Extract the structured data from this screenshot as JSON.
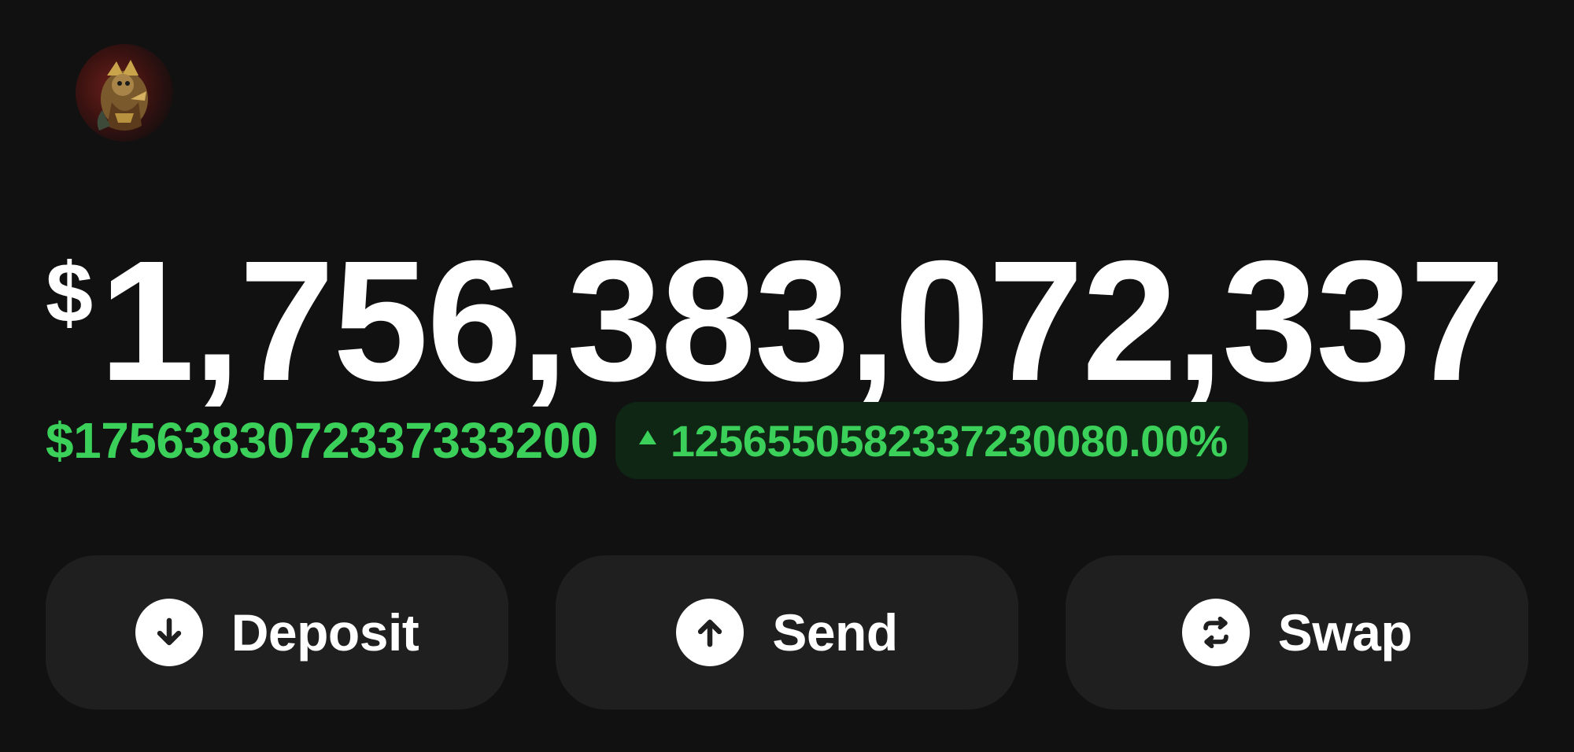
{
  "profile": {
    "avatar_icon": "character-avatar-icon"
  },
  "balance": {
    "currency_symbol": "$",
    "amount_display": "1,756,383,072,337"
  },
  "summary": {
    "value_text": "$17563830723373332​00",
    "change_direction_icon": "triangle-up-icon",
    "change_text": "1256550582337230080.00%",
    "positive_color": "#3bd05a"
  },
  "actions": [
    {
      "label": "Deposit",
      "icon": "arrow-down-circle-icon"
    },
    {
      "label": "Send",
      "icon": "arrow-up-circle-icon"
    },
    {
      "label": "Swap",
      "icon": "swap-arrows-icon"
    }
  ]
}
